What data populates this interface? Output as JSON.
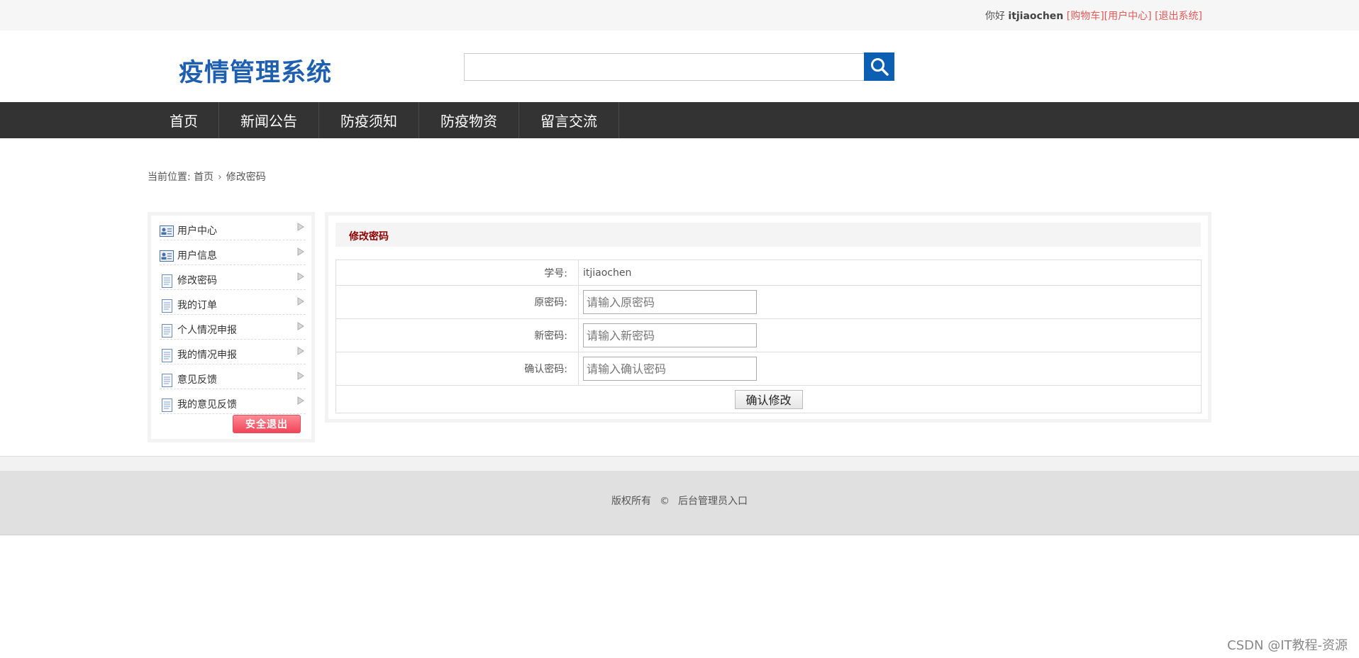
{
  "topbar": {
    "greeting": "你好",
    "username": "itjiaochen",
    "links": [
      "[购物车]",
      "[用户中心]",
      "[退出系统]"
    ]
  },
  "header": {
    "logo": "疫情管理系统",
    "search_placeholder": "",
    "search_icon": "search-icon"
  },
  "nav": {
    "items": [
      "首页",
      "新闻公告",
      "防疫须知",
      "防疫物资",
      "留言交流"
    ]
  },
  "breadcrumb": {
    "prefix": "当前位置: ",
    "home": "首页",
    "current": "修改密码"
  },
  "sidebar": {
    "items": [
      {
        "label": "用户中心",
        "icon": "user-card-icon"
      },
      {
        "label": "用户信息",
        "icon": "user-card-icon"
      },
      {
        "label": "修改密码",
        "icon": "document-icon"
      },
      {
        "label": "我的订单",
        "icon": "document-icon"
      },
      {
        "label": "个人情况申报",
        "icon": "document-icon"
      },
      {
        "label": "我的情况申报",
        "icon": "document-icon"
      },
      {
        "label": "意见反馈",
        "icon": "document-icon"
      },
      {
        "label": "我的意见反馈",
        "icon": "document-icon"
      }
    ],
    "logout_label": "安全退出"
  },
  "panel": {
    "title": "修改密码",
    "fields": {
      "student_id_label": "学号:",
      "student_id_value": "itjiaochen",
      "old_pw_label": "原密码:",
      "old_pw_placeholder": "请输入原密码",
      "new_pw_label": "新密码:",
      "new_pw_placeholder": "请输入新密码",
      "confirm_pw_label": "确认密码:",
      "confirm_pw_placeholder": "请输入确认密码"
    },
    "submit_label": "确认修改"
  },
  "footer": {
    "copyright": "版权所有",
    "symbol": "©",
    "admin_link": "后台管理员入口"
  },
  "watermark": "CSDN @IT教程-资源",
  "colors": {
    "brand_blue": "#1f5fb0",
    "search_button": "#0d5fb3",
    "nav_bg": "#333333",
    "link_red": "#e05a5a",
    "title_red": "#8b0000"
  }
}
